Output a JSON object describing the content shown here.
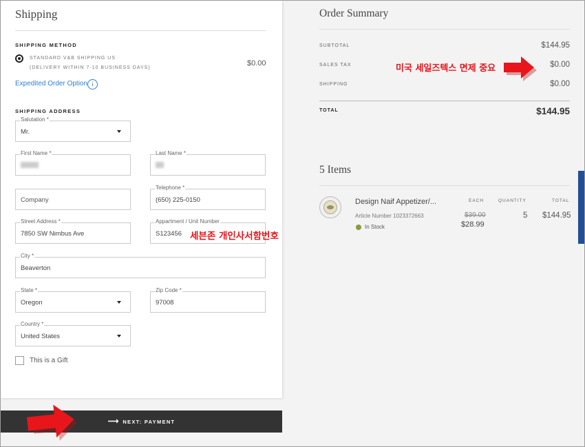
{
  "shipping": {
    "title": "Shipping",
    "method_label": "SHIPPING METHOD",
    "method_name": "STANDARD V&B SHIPPING US",
    "method_sub": "(DELIVERY WITHIN 7-10 BUSINESS DAYS)",
    "method_price": "$0.00",
    "expedited_link": "Expedited Order Option",
    "info_icon": "i",
    "address_label": "SHIPPING ADDRESS",
    "fields": {
      "salutation": {
        "label": "Salutation *",
        "value": "Mr."
      },
      "first_name": {
        "label": "First Name *"
      },
      "last_name": {
        "label": "Last Name *"
      },
      "company": {
        "placeholder": "Company"
      },
      "telephone": {
        "label": "Telephone *",
        "value": "(650) 225-0150"
      },
      "street": {
        "label": "Street Address *",
        "value": "7850 SW Nimbus Ave"
      },
      "apartment": {
        "label": "Appartment / Unit Number",
        "value": "S123456"
      },
      "city": {
        "label": "City *",
        "value": "Beaverton"
      },
      "state": {
        "label": "State *",
        "value": "Oregon"
      },
      "zip": {
        "label": "Zip Code *",
        "value": "97008"
      },
      "country": {
        "label": "Country *",
        "value": "United States"
      }
    },
    "gift_label": "This is a Gift",
    "next_button": "NEXT: PAYMENT",
    "next_arrow": "⟶"
  },
  "annotations": {
    "apartment_note": "세븐존 개인사서함번호",
    "tax_note": "미국 세일즈텍스 면제 중요",
    "arrow_color": "#e8151b"
  },
  "summary": {
    "title": "Order Summary",
    "subtotal_label": "SUBTOTAL",
    "subtotal": "$144.95",
    "tax_label": "SALES TAX",
    "tax": "$0.00",
    "shipping_label": "SHIPPING",
    "shipping": "$0.00",
    "total_label": "TOTAL",
    "total": "$144.95"
  },
  "items": {
    "title": "5 Items",
    "col_each": "EACH",
    "col_quantity": "QUANTITY",
    "col_total": "TOTAL",
    "list": [
      {
        "name": "Design Naif Appetizer/...",
        "article": "Article Number 1023372663",
        "stock": "In Stock",
        "old_price": "$39.00",
        "price": "$28.99",
        "quantity": "5",
        "total": "$144.95"
      }
    ]
  },
  "colors": {
    "link": "#2e7fd2",
    "button_bg": "#333333",
    "in_stock": "#8a9a3d",
    "side_tab": "#1f4f98"
  }
}
